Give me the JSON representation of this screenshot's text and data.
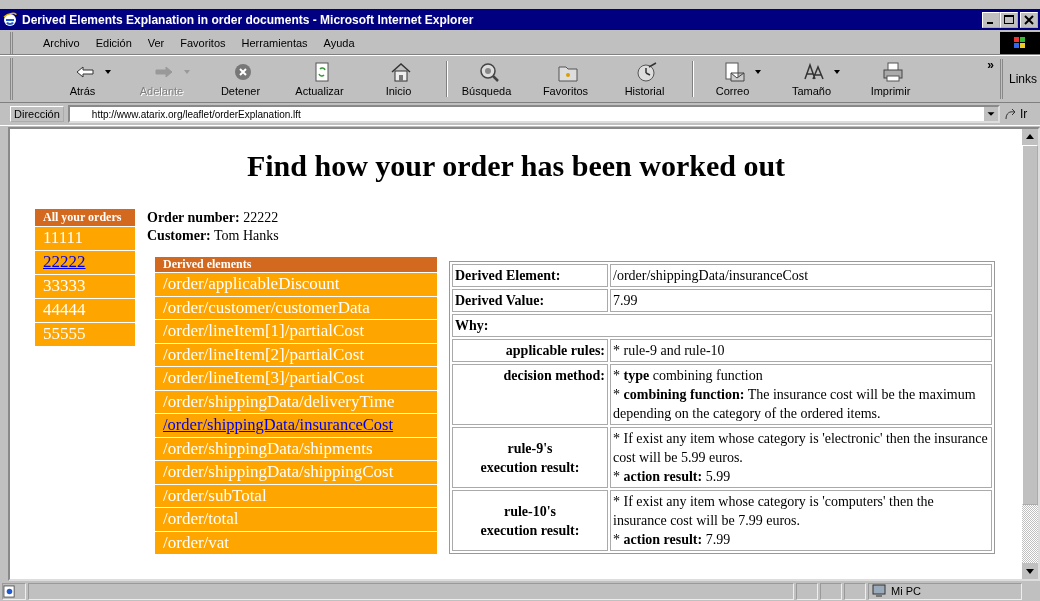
{
  "window": {
    "title": "Derived Elements Explanation in order documents - Microsoft Internet Explorer"
  },
  "menu": [
    "Archivo",
    "Edición",
    "Ver",
    "Favoritos",
    "Herramientas",
    "Ayuda"
  ],
  "toolbar": [
    {
      "label": "Atrás",
      "disabled": false,
      "dropdown": true,
      "separator_before": false
    },
    {
      "label": "Adelante",
      "disabled": true,
      "dropdown": true,
      "separator_before": false
    },
    {
      "label": "Detener",
      "disabled": false,
      "dropdown": false,
      "separator_before": false
    },
    {
      "label": "Actualizar",
      "disabled": false,
      "dropdown": false,
      "separator_before": false
    },
    {
      "label": "Inicio",
      "disabled": false,
      "dropdown": false,
      "separator_before": false
    },
    {
      "label": "Búsqueda",
      "disabled": false,
      "dropdown": false,
      "separator_before": true
    },
    {
      "label": "Favoritos",
      "disabled": false,
      "dropdown": false,
      "separator_before": false
    },
    {
      "label": "Historial",
      "disabled": false,
      "dropdown": false,
      "separator_before": false
    },
    {
      "label": "Correo",
      "disabled": false,
      "dropdown": true,
      "separator_before": true
    },
    {
      "label": "Tamaño",
      "disabled": false,
      "dropdown": true,
      "separator_before": false
    },
    {
      "label": "Imprimir",
      "disabled": false,
      "dropdown": false,
      "separator_before": false
    }
  ],
  "toolbar_more": "»",
  "links_label": "Links",
  "address": {
    "label": "Dirección",
    "value": "http://www.atarix.org/leaflet/orderExplanation.lft",
    "go": "Ir"
  },
  "page": {
    "heading": "Find how your order has been worked out",
    "orders_title": "All your orders",
    "orders": [
      {
        "label": "11111",
        "selected": false
      },
      {
        "label": "22222",
        "selected": true
      },
      {
        "label": "33333",
        "selected": false
      },
      {
        "label": "44444",
        "selected": false
      },
      {
        "label": "55555",
        "selected": false
      }
    ],
    "order_number": {
      "label": "Order number:",
      "value": "22222"
    },
    "customer": {
      "label": "Customer:",
      "value": "Tom Hanks"
    },
    "derived_title": "Derived elements",
    "derived": [
      {
        "label": "/order/applicableDiscount",
        "selected": false
      },
      {
        "label": "/order/customer/customerData",
        "selected": false
      },
      {
        "label": "/order/lineItem[1]/partialCost",
        "selected": false
      },
      {
        "label": "/order/lineItem[2]/partialCost",
        "selected": false
      },
      {
        "label": "/order/lineItem[3]/partialCost",
        "selected": false
      },
      {
        "label": "/order/shippingData/deliveryTime",
        "selected": false
      },
      {
        "label": "/order/shippingData/insuranceCost",
        "selected": true
      },
      {
        "label": "/order/shippingData/shipments",
        "selected": false
      },
      {
        "label": "/order/shippingData/shippingCost",
        "selected": false
      },
      {
        "label": "/order/subTotal",
        "selected": false
      },
      {
        "label": "/order/total",
        "selected": false
      },
      {
        "label": "/order/vat",
        "selected": false
      }
    ],
    "details": [
      {
        "kind": "field",
        "label": [
          "Derived Element:"
        ],
        "lines": [
          "/order/shippingData/insuranceCost"
        ]
      },
      {
        "kind": "field",
        "label": [
          "Derived Value:"
        ],
        "lines": [
          "7.99"
        ]
      },
      {
        "kind": "section",
        "label": [
          "Why:"
        ]
      },
      {
        "kind": "rule",
        "label": [
          "applicable rules:"
        ],
        "lines": [
          "* rule-9 and rule-10"
        ]
      },
      {
        "kind": "rule",
        "label": [
          "decision method:"
        ],
        "lines": [
          "* **type** combining function",
          "* **combining function:** The insurance cost will be the maximum depending on the category of the ordered items."
        ]
      },
      {
        "kind": "result",
        "label": [
          "rule-9's",
          "execution result:"
        ],
        "lines": [
          "* If exist any item whose category is 'electronic' then the insurance cost will be 5.99 euros.",
          "* **action result:** 5.99"
        ]
      },
      {
        "kind": "result",
        "label": [
          "rule-10's",
          "execution result:"
        ],
        "lines": [
          "* If exist any item whose category is 'computers' then the insurance cost will be 7.99 euros.",
          "* **action result:** 7.99"
        ]
      }
    ]
  },
  "status_bar": {
    "zone": "Mi PC"
  }
}
